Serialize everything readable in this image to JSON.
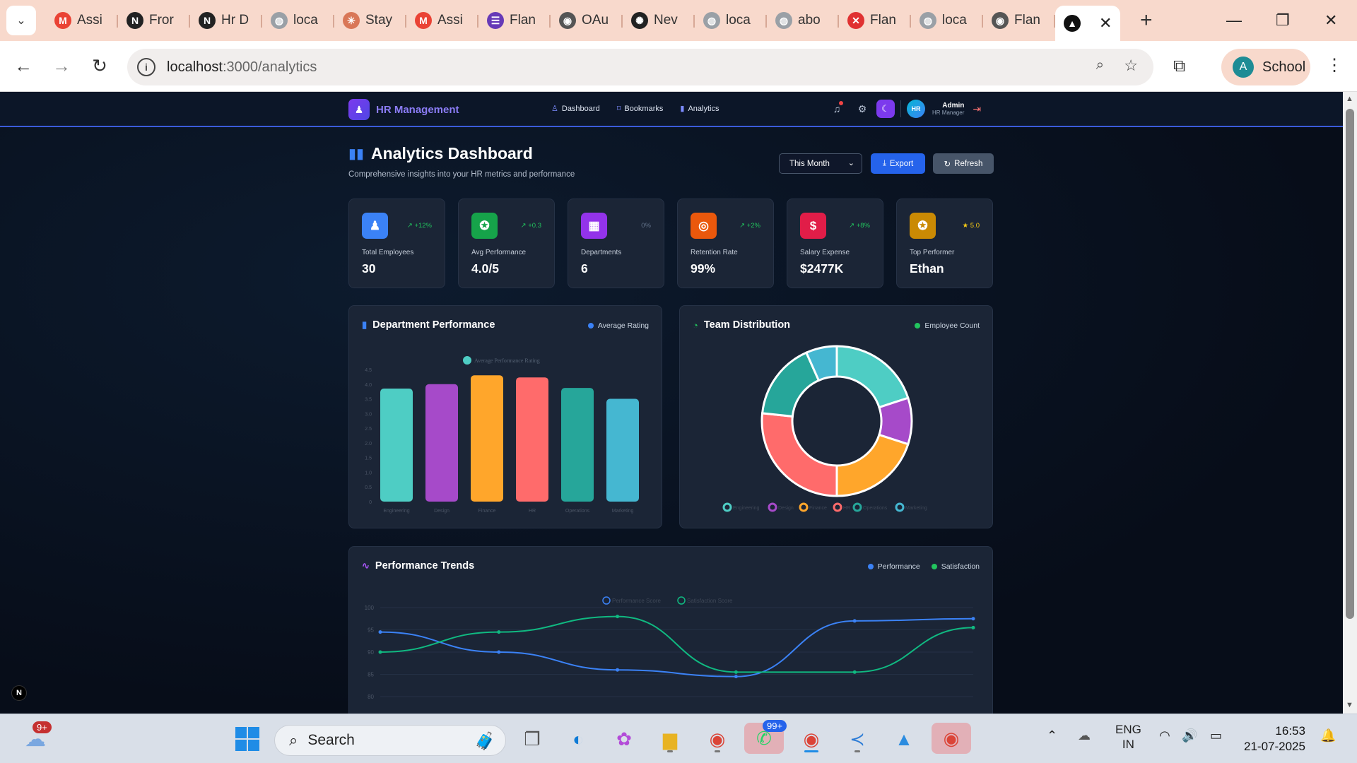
{
  "browser": {
    "tabs": [
      {
        "label": "Assi",
        "icon": "gmail-icon",
        "color": "#ea4335",
        "glyph": "M"
      },
      {
        "label": "Fror",
        "icon": "notion-icon",
        "color": "#222222",
        "glyph": "N"
      },
      {
        "label": "Hr D",
        "icon": "notion-icon",
        "color": "#222222",
        "glyph": "N"
      },
      {
        "label": "loca",
        "icon": "globe-icon",
        "color": "#9aa0a6",
        "glyph": "◍"
      },
      {
        "label": "Stay",
        "icon": "claude-icon",
        "color": "#d97757",
        "glyph": "✳"
      },
      {
        "label": "Assi",
        "icon": "gmail-icon",
        "color": "#ea4335",
        "glyph": "M"
      },
      {
        "label": "Flan",
        "icon": "form-icon",
        "color": "#673ab7",
        "glyph": "☰"
      },
      {
        "label": "OAu",
        "icon": "github-icon",
        "color": "#555555",
        "glyph": "◉"
      },
      {
        "label": "Nev",
        "icon": "chatgpt-icon",
        "color": "#222222",
        "glyph": "✺"
      },
      {
        "label": "loca",
        "icon": "globe-icon",
        "color": "#9aa0a6",
        "glyph": "◍"
      },
      {
        "label": "abo",
        "icon": "globe-icon",
        "color": "#9aa0a6",
        "glyph": "◍"
      },
      {
        "label": "Flan",
        "icon": "flan-icon",
        "color": "#e03131",
        "glyph": "✕"
      },
      {
        "label": "loca",
        "icon": "globe-icon",
        "color": "#9aa0a6",
        "glyph": "◍"
      },
      {
        "label": "Flan",
        "icon": "github-icon",
        "color": "#555555",
        "glyph": "◉"
      }
    ],
    "active_tab_icon": "vercel-icon",
    "url_host": "localhost",
    "url_path": ":3000/analytics",
    "profile_initial": "A",
    "profile_name": "School"
  },
  "app": {
    "brand": "HR Management",
    "nav": [
      {
        "label": "Dashboard",
        "icon": "user-icon",
        "glyph": "♙"
      },
      {
        "label": "Bookmarks",
        "icon": "bookmark-icon",
        "glyph": "⌑"
      },
      {
        "label": "Analytics",
        "icon": "bar-chart-icon",
        "glyph": "▮"
      }
    ],
    "avatar_initials": "HR",
    "user_name": "Admin",
    "user_role": "HR Manager"
  },
  "header": {
    "title": "Analytics Dashboard",
    "subtitle": "Comprehensive insights into your HR metrics and performance",
    "period": "This Month",
    "export_label": "Export",
    "refresh_label": "Refresh"
  },
  "stats": [
    {
      "label": "Total Employees",
      "value": "30",
      "delta": "+12%",
      "color": "#3b82f6",
      "icon": "users-icon",
      "glyph": "♟",
      "kind": "up"
    },
    {
      "label": "Avg Performance",
      "value": "4.0/5",
      "delta": "+0.3",
      "color": "#16a34a",
      "icon": "award-icon",
      "glyph": "✪",
      "kind": "up"
    },
    {
      "label": "Departments",
      "value": "6",
      "delta": "0%",
      "color": "#9333ea",
      "icon": "building-icon",
      "glyph": "▦",
      "kind": "neutral"
    },
    {
      "label": "Retention Rate",
      "value": "99%",
      "delta": "+2%",
      "color": "#ea580c",
      "icon": "target-icon",
      "glyph": "◎",
      "kind": "up"
    },
    {
      "label": "Salary Expense",
      "value": "$2477K",
      "delta": "+8%",
      "color": "#e11d48",
      "icon": "dollar-icon",
      "glyph": "$",
      "kind": "up"
    },
    {
      "label": "Top Performer",
      "value": "Ethan",
      "delta": "5.0",
      "color": "#ca8a04",
      "icon": "award-icon",
      "glyph": "✪",
      "kind": "gold"
    }
  ],
  "panels": {
    "department": {
      "title": "Department Performance",
      "legend": "Average Rating",
      "legend_color": "#3b82f6"
    },
    "team": {
      "title": "Team Distribution",
      "legend": "Employee Count",
      "legend_color": "#22c55e"
    },
    "trends": {
      "title": "Performance Trends",
      "legend_a": "Performance",
      "legend_a_color": "#3b82f6",
      "legend_b": "Satisfaction",
      "legend_b_color": "#22c55e"
    }
  },
  "chart_data": [
    {
      "type": "bar",
      "title": "",
      "series_label": "Average Performance Rating",
      "categories": [
        "Engineering",
        "Design",
        "Finance",
        "HR",
        "Operations",
        "Marketing"
      ],
      "values": [
        3.85,
        4.0,
        4.3,
        4.23,
        3.87,
        3.5
      ],
      "colors": [
        "#4ecdc4",
        "#a64ac9",
        "#ffa62b",
        "#ff6b6b",
        "#26a69a",
        "#45b7d1"
      ],
      "ylim": [
        0,
        4.5
      ],
      "yticks": [
        "0",
        "0.5",
        "1.0",
        "1.5",
        "2.0",
        "2.5",
        "3.0",
        "3.5",
        "4.0",
        "4.5"
      ]
    },
    {
      "type": "pie",
      "title": "",
      "categories": [
        "Engineering",
        "Design",
        "Finance",
        "HR",
        "Operations",
        "Marketing"
      ],
      "values": [
        6,
        3,
        6,
        8,
        5,
        2
      ],
      "colors": [
        "#4ecdc4",
        "#a64ac9",
        "#ffa62b",
        "#ff6b6b",
        "#26a69a",
        "#45b7d1"
      ]
    },
    {
      "type": "line",
      "title": "",
      "series": [
        {
          "name": "Performance Score",
          "values": [
            94.5,
            90,
            86,
            84.5,
            97,
            97.5
          ],
          "color": "#3b82f6"
        },
        {
          "name": "Satisfaction Score",
          "values": [
            90,
            94.5,
            98,
            85.5,
            85.5,
            95.5
          ],
          "color": "#10b981"
        }
      ],
      "ylim": [
        80,
        100
      ],
      "yticks": [
        "80",
        "85",
        "90",
        "95",
        "100"
      ]
    }
  ],
  "taskbar": {
    "weather_badge": "9+",
    "search_label": "Search",
    "whatsapp_badge": "99+",
    "lang_1": "ENG",
    "lang_2": "IN",
    "time": "16:53",
    "date": "21-07-2025"
  }
}
